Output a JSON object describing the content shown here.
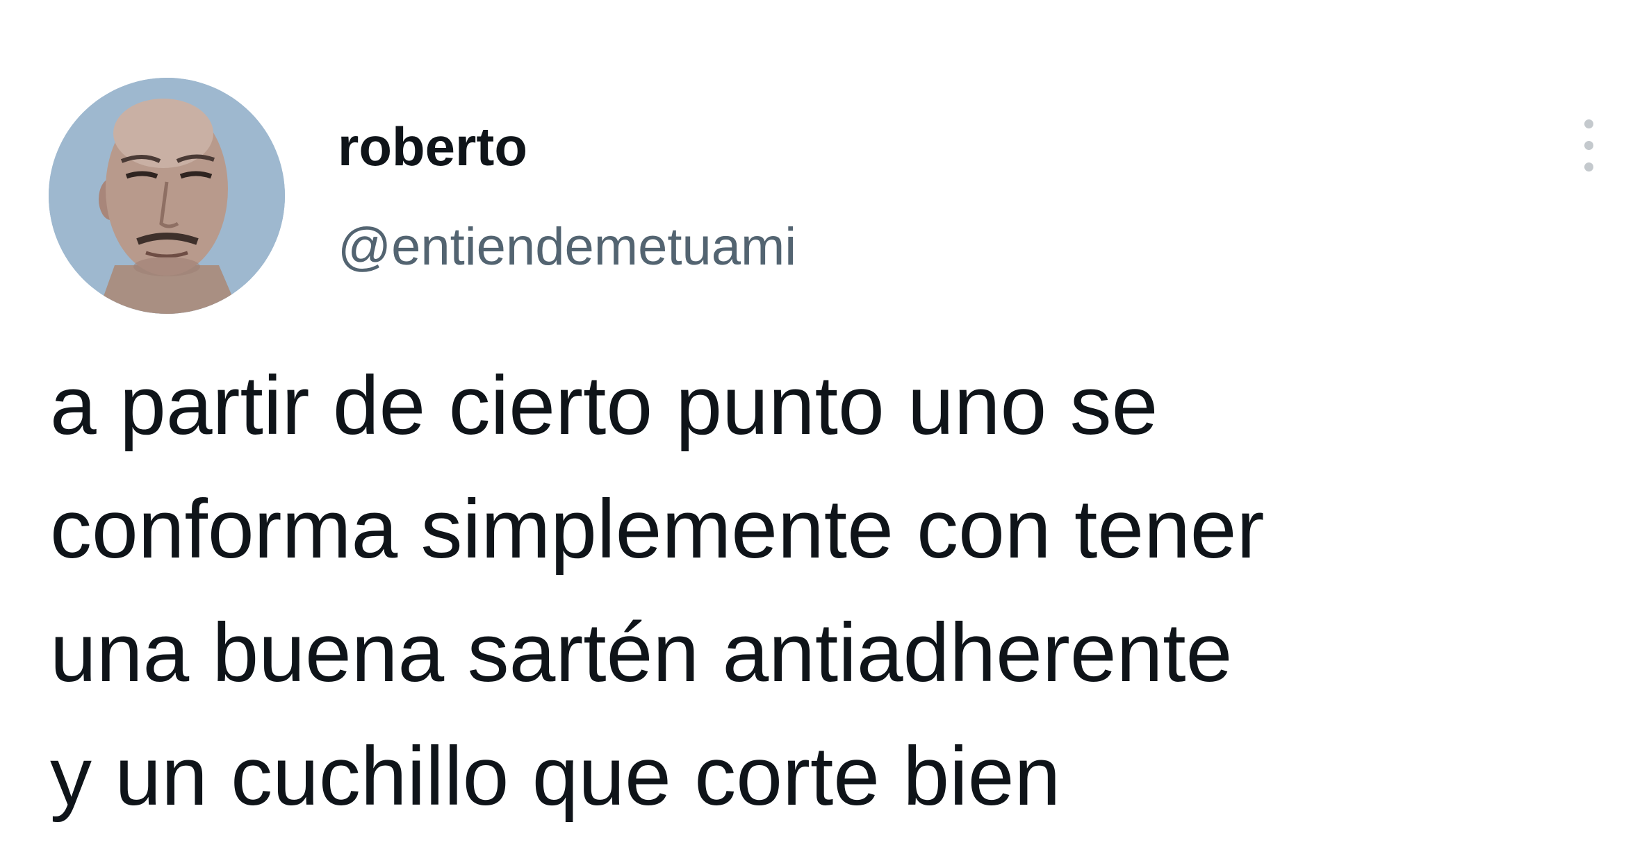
{
  "author": {
    "display_name": "roberto",
    "handle": "@entiendemetuami",
    "avatar_icon": "user-avatar-photo"
  },
  "tweet": {
    "text": "a partir de cierto punto uno se\nconforma simplemente con tener\nuna buena sartén antiadherente\ny un cuchillo que corte bien"
  },
  "controls": {
    "more_icon": "more-vertical-icon"
  },
  "colors": {
    "background": "#ffffff",
    "text_primary": "#0f1419",
    "text_secondary": "#536471",
    "icon_muted": "#c4c9cd"
  }
}
